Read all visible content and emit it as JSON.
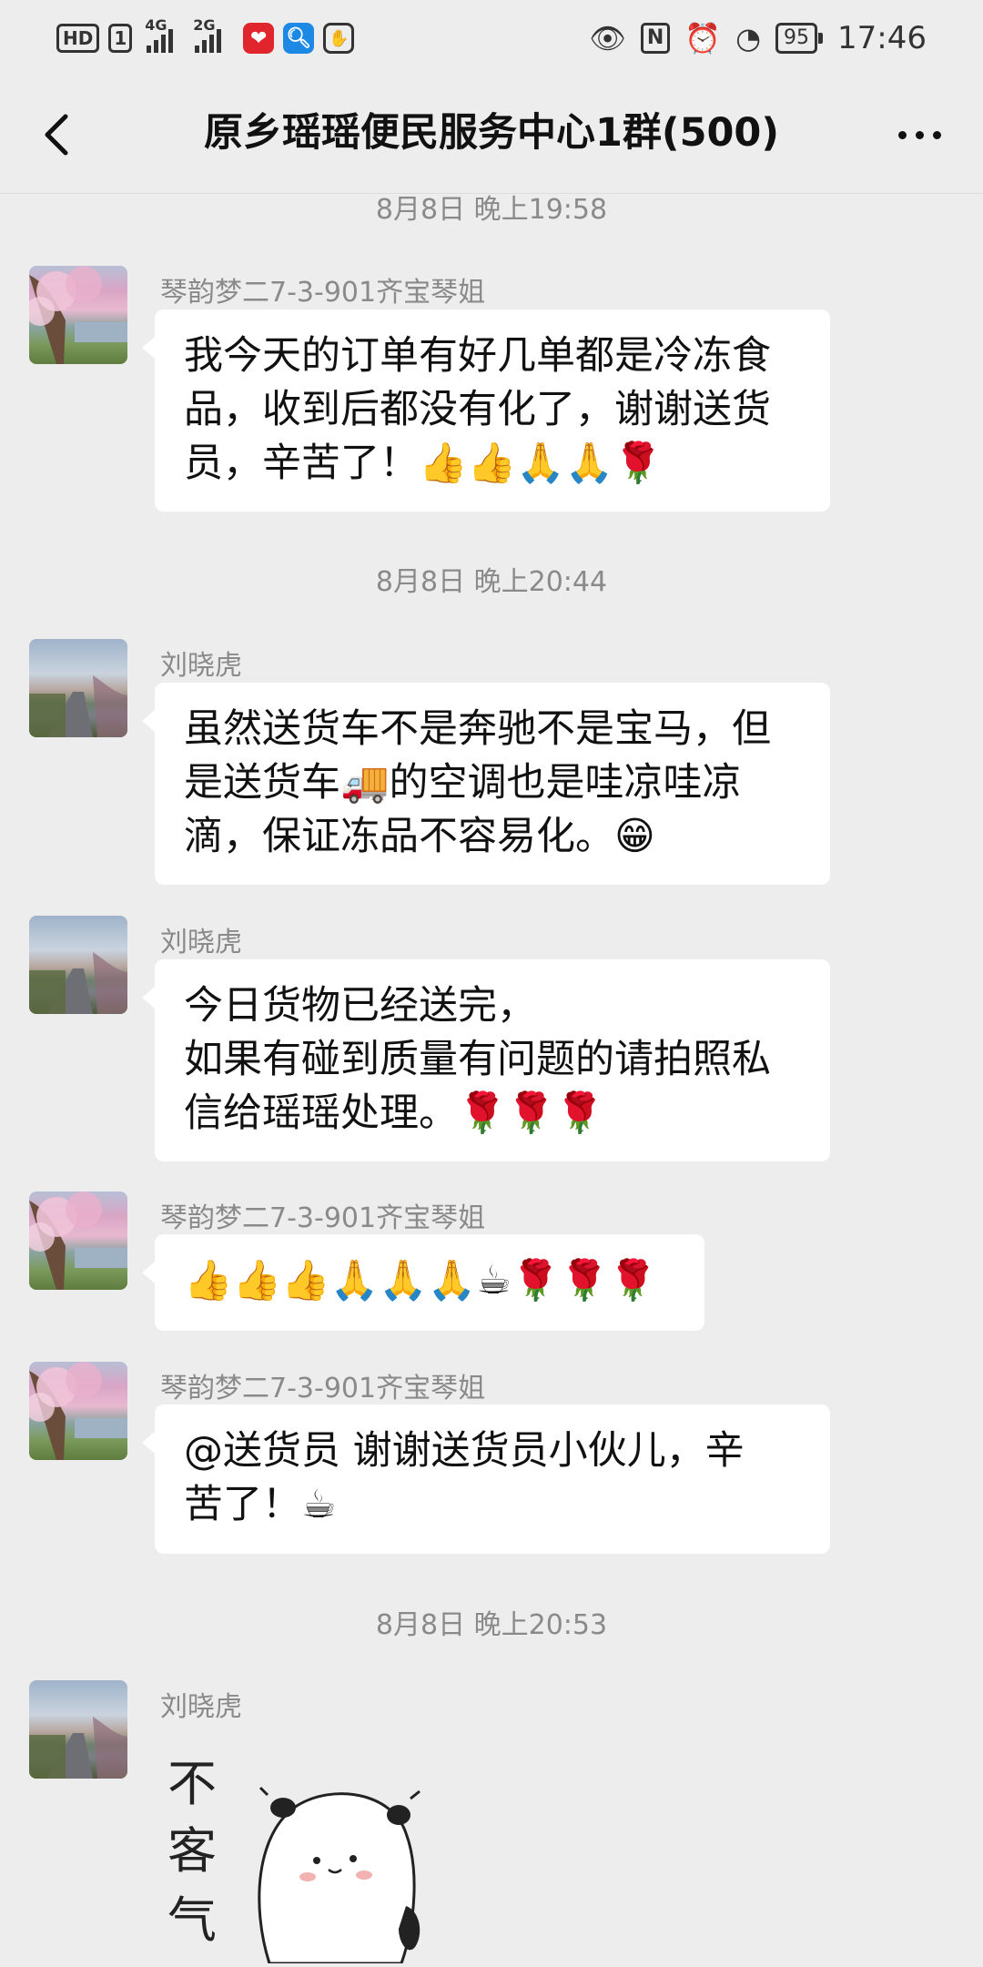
{
  "status_bar": {
    "hd": "HD",
    "sim1": "1",
    "net1": "4G",
    "net2": "2G",
    "battery": "95",
    "time": "17:46",
    "icons": [
      "eye-icon",
      "nfc-icon",
      "alarm-icon",
      "speed-icon"
    ]
  },
  "header": {
    "title": "原乡瑶瑶便民服务中心1群(500)",
    "back_icon": "chevron-left-icon",
    "more_icon": "more-dots-icon"
  },
  "timestamps": [
    "8月8日 晚上19:58",
    "8月8日 晚上20:44",
    "8月8日 晚上20:53"
  ],
  "messages": [
    {
      "sender": "琴韵梦二7-3-901齐宝琴姐",
      "avatar": "blossom-avatar",
      "lines": [
        "我今天的订单有好几单都是冷冻食",
        "品，收到后都没有化了，谢谢送货",
        "员，辛苦了！👍👍🙏🙏🌹"
      ]
    },
    {
      "sender": "刘晓虎",
      "avatar": "road-avatar",
      "lines": [
        "虽然送货车不是奔驰不是宝马，但",
        "是送货车🚚的空调也是哇凉哇凉",
        "滴，保证冻品不容易化。😁"
      ]
    },
    {
      "sender": "刘晓虎",
      "avatar": "road-avatar",
      "lines": [
        "今日货物已经送完，",
        "如果有碰到质量有问题的请拍照私",
        "信给瑶瑶处理。🌹🌹🌹"
      ]
    },
    {
      "sender": "琴韵梦二7-3-901齐宝琴姐",
      "avatar": "blossom-avatar",
      "lines": [
        "👍👍👍🙏🙏🙏☕🌹🌹🌹"
      ]
    },
    {
      "sender": "琴韵梦二7-3-901齐宝琴姐",
      "avatar": "blossom-avatar",
      "lines": [
        "@送货员  谢谢送货员小伙儿，辛",
        "苦了！☕"
      ]
    },
    {
      "sender": "刘晓虎",
      "avatar": "road-avatar",
      "sticker_text": [
        "不",
        "客",
        "气"
      ]
    }
  ],
  "colors": {
    "background": "#ededed",
    "bubble": "#ffffff",
    "meta_text": "#8a8a8a"
  }
}
